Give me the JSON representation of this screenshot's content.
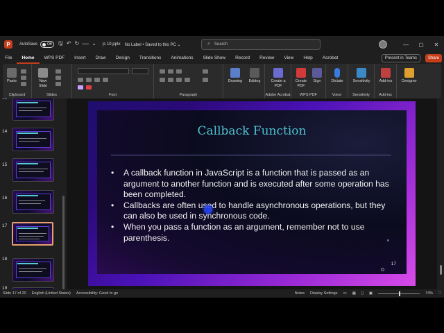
{
  "title_bar": {
    "autosave_label": "AutoSave",
    "autosave_state": "Off",
    "document_name": "js 10.pptx",
    "label_info": "No Label • Saved to this PC ⌄",
    "search_placeholder": "Search",
    "window_buttons": [
      "—",
      "▢",
      "✕"
    ]
  },
  "menu": {
    "items": [
      "File",
      "Home",
      "WPS PDF",
      "Insert",
      "Draw",
      "Design",
      "Transitions",
      "Animations",
      "Slide Show",
      "Record",
      "Review",
      "View",
      "Help",
      "Acrobat"
    ],
    "active": "Home",
    "present_label": "Present in Teams",
    "share_label": "Share"
  },
  "ribbon": {
    "groups": [
      "Clipboard",
      "Slides",
      "Font",
      "Paragraph",
      "Adobe Acrobat",
      "WPS PDF",
      "Voice",
      "Sensitivity",
      "Add-ins"
    ],
    "buttons": {
      "paste": "Paste",
      "new_slide": "New Slide",
      "drawing": "Drawing",
      "editing": "Editing",
      "create_pdf_acrobat": "Create a PDF",
      "create_pdf_wps": "Create PDF",
      "sign": "Sign",
      "dictate": "Dictate",
      "sensitivity": "Sensitivity",
      "addins": "Add-ins",
      "designer": "Designer"
    }
  },
  "thumbnails": {
    "numbers": [
      "13",
      "14",
      "15",
      "16",
      "17",
      "18",
      "19"
    ],
    "active_number": "17"
  },
  "slide": {
    "title": "Callback Function",
    "bullets": [
      "A callback function in JavaScript is a function that is passed as an argument to another function and is executed after some operation has been completed.",
      "Callbacks are often used to handle asynchronous operations, but they can also be used in synchronous code.",
      "When you pass a function as an argument, remember not to use parenthesis."
    ],
    "bullet_char": "•",
    "number": "17"
  },
  "status_bar": {
    "slide_info": "Slide 17 of 20",
    "language": "English (United States)",
    "accessibility": "Accessibility: Good to go",
    "notes": "Notes",
    "display_settings": "Display Settings",
    "zoom": "74%"
  },
  "colors": {
    "accent": "#c43e1c",
    "title_text": "#4fc3d1",
    "thumbnail_highlight": "#e7a06d"
  }
}
